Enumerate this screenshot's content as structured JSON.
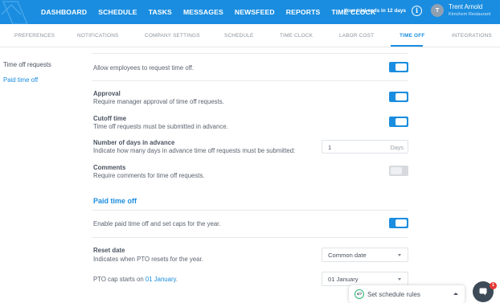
{
  "colors": {
    "brand": "#1a8de0",
    "toggle_off": "#d6dadf",
    "text": "#4a5360",
    "badge_red": "#e53935"
  },
  "topnav": {
    "logo_icon": "app-logo-icon",
    "items": [
      "DASHBOARD",
      "SCHEDULE",
      "TASKS",
      "MESSAGES",
      "NEWSFEED",
      "REPORTS",
      "TIME CLOCK"
    ],
    "trial_text": "Your trial ends in 12 days",
    "info_icon": "info-icon",
    "user": {
      "initial": "T",
      "name": "Trent Arnold",
      "org": "Kimchem Restaurant"
    }
  },
  "subnav": {
    "tabs": [
      "PREFERENCES",
      "NOTIFICATIONS",
      "COMPANY SETTINGS",
      "SCHEDULE",
      "TIME CLOCK",
      "LABOR COST",
      "TIME OFF",
      "INTEGRATIONS"
    ],
    "active": "TIME OFF"
  },
  "sidenav": {
    "items": [
      "Time off requests",
      "Paid time off"
    ],
    "active": "Paid time off"
  },
  "time_off_requests": {
    "allow": {
      "desc": "Allow employees to request time off.",
      "enabled": true
    },
    "approval": {
      "title": "Approval",
      "desc": "Require manager approval of time off requests.",
      "enabled": true
    },
    "cutoff": {
      "title": "Cutoff time",
      "desc": "Time off requests must be submitted in advance.",
      "enabled": true
    },
    "days_in_advance": {
      "title": "Number of days in advance",
      "desc": "Indicate how many days in advance time off requests must be submitted:",
      "value": "1",
      "unit": "Days"
    },
    "comments": {
      "title": "Comments",
      "desc": "Require comments for time off requests.",
      "enabled": false
    }
  },
  "paid_time_off": {
    "heading": "Paid time off",
    "enable": {
      "desc": "Enable paid time off and set caps for the year.",
      "enabled": true
    },
    "reset_date": {
      "title": "Reset date",
      "desc": "Indicates when PTO resets for the year.",
      "selected": "Common date"
    },
    "cap_start": {
      "desc_prefix": "PTO cap starts on",
      "link": "01 January",
      "desc_suffix": ".",
      "selected": "01 January"
    }
  },
  "schedule_rules": {
    "progress": "4/7",
    "label": "Set schedule rules"
  },
  "chat": {
    "icon": "chat-icon",
    "badge": "1"
  }
}
